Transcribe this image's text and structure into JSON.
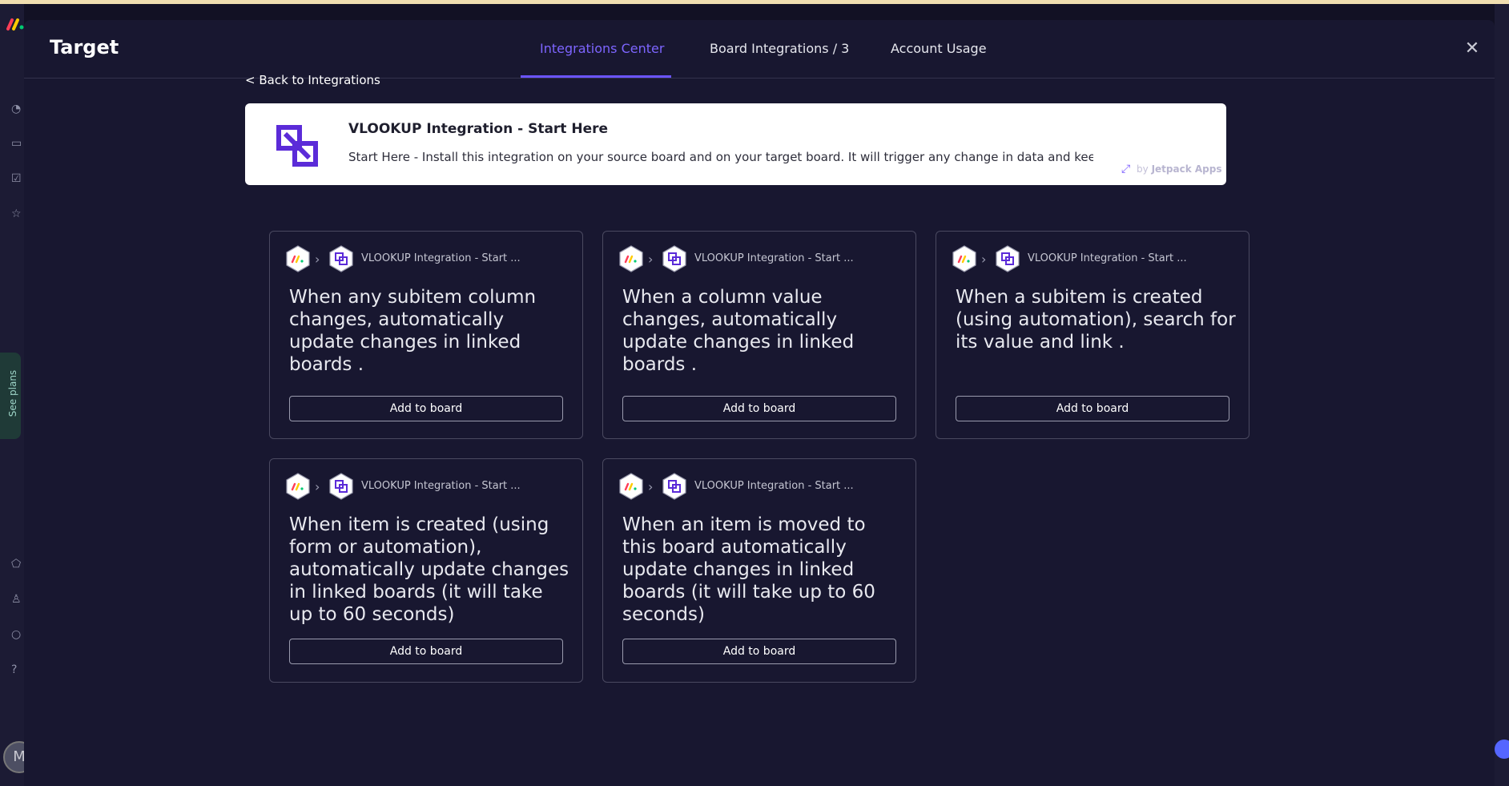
{
  "modal": {
    "title": "Target",
    "close_icon": "close-icon"
  },
  "tabs": [
    {
      "label": "Integrations Center",
      "active": true
    },
    {
      "label": "Board Integrations / 3",
      "active": false
    },
    {
      "label": "Account Usage",
      "active": false
    }
  ],
  "back_link": "< Back to Integrations",
  "banner": {
    "title": "VLOOKUP Integration - Start Here",
    "description": "Start Here - Install this integration on your source board and on your target board. It will trigger any change in data and keep it up...",
    "by_prefix": "by",
    "by_name": "Jetpack Apps"
  },
  "sidebar": {
    "see_plans": "See plans",
    "avatar_initial": "M"
  },
  "cards": [
    {
      "app": "VLOOKUP Integration - Start ...",
      "text": "When any subitem column changes, automatically update changes in linked boards .",
      "button": "Add to board"
    },
    {
      "app": "VLOOKUP Integration - Start ...",
      "text": "When a column value changes, automatically update changes in linked boards .",
      "button": "Add to board"
    },
    {
      "app": "VLOOKUP Integration - Start ...",
      "text": "When a subitem is created (using automation), search for its value and link .",
      "button": "Add to board"
    },
    {
      "app": "VLOOKUP Integration - Start ...",
      "text": "When item is created (using form or automation), automatically update changes in linked boards (it will take up to 60 seconds)",
      "button": "Add to board"
    },
    {
      "app": "VLOOKUP Integration - Start ...",
      "text": "When an item is moved to this board automatically update changes in linked boards (it will take up to 60 seconds)",
      "button": "Add to board"
    }
  ],
  "colors": {
    "accent": "#6b54ff",
    "background": "#181730",
    "card_border": "#4a4960"
  }
}
